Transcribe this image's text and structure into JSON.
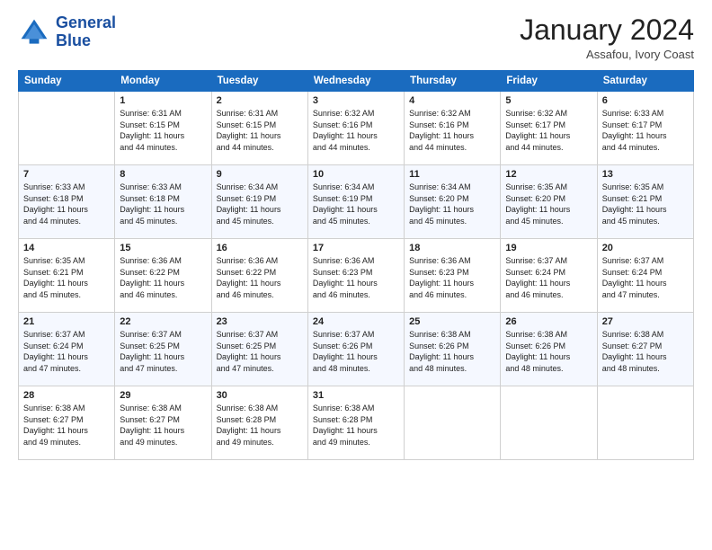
{
  "header": {
    "logo_line1": "General",
    "logo_line2": "Blue",
    "month_title": "January 2024",
    "location": "Assafou, Ivory Coast"
  },
  "weekdays": [
    "Sunday",
    "Monday",
    "Tuesday",
    "Wednesday",
    "Thursday",
    "Friday",
    "Saturday"
  ],
  "weeks": [
    [
      {
        "day": "",
        "info": ""
      },
      {
        "day": "1",
        "info": "Sunrise: 6:31 AM\nSunset: 6:15 PM\nDaylight: 11 hours\nand 44 minutes."
      },
      {
        "day": "2",
        "info": "Sunrise: 6:31 AM\nSunset: 6:15 PM\nDaylight: 11 hours\nand 44 minutes."
      },
      {
        "day": "3",
        "info": "Sunrise: 6:32 AM\nSunset: 6:16 PM\nDaylight: 11 hours\nand 44 minutes."
      },
      {
        "day": "4",
        "info": "Sunrise: 6:32 AM\nSunset: 6:16 PM\nDaylight: 11 hours\nand 44 minutes."
      },
      {
        "day": "5",
        "info": "Sunrise: 6:32 AM\nSunset: 6:17 PM\nDaylight: 11 hours\nand 44 minutes."
      },
      {
        "day": "6",
        "info": "Sunrise: 6:33 AM\nSunset: 6:17 PM\nDaylight: 11 hours\nand 44 minutes."
      }
    ],
    [
      {
        "day": "7",
        "info": "Sunrise: 6:33 AM\nSunset: 6:18 PM\nDaylight: 11 hours\nand 44 minutes."
      },
      {
        "day": "8",
        "info": "Sunrise: 6:33 AM\nSunset: 6:18 PM\nDaylight: 11 hours\nand 45 minutes."
      },
      {
        "day": "9",
        "info": "Sunrise: 6:34 AM\nSunset: 6:19 PM\nDaylight: 11 hours\nand 45 minutes."
      },
      {
        "day": "10",
        "info": "Sunrise: 6:34 AM\nSunset: 6:19 PM\nDaylight: 11 hours\nand 45 minutes."
      },
      {
        "day": "11",
        "info": "Sunrise: 6:34 AM\nSunset: 6:20 PM\nDaylight: 11 hours\nand 45 minutes."
      },
      {
        "day": "12",
        "info": "Sunrise: 6:35 AM\nSunset: 6:20 PM\nDaylight: 11 hours\nand 45 minutes."
      },
      {
        "day": "13",
        "info": "Sunrise: 6:35 AM\nSunset: 6:21 PM\nDaylight: 11 hours\nand 45 minutes."
      }
    ],
    [
      {
        "day": "14",
        "info": "Sunrise: 6:35 AM\nSunset: 6:21 PM\nDaylight: 11 hours\nand 45 minutes."
      },
      {
        "day": "15",
        "info": "Sunrise: 6:36 AM\nSunset: 6:22 PM\nDaylight: 11 hours\nand 46 minutes."
      },
      {
        "day": "16",
        "info": "Sunrise: 6:36 AM\nSunset: 6:22 PM\nDaylight: 11 hours\nand 46 minutes."
      },
      {
        "day": "17",
        "info": "Sunrise: 6:36 AM\nSunset: 6:23 PM\nDaylight: 11 hours\nand 46 minutes."
      },
      {
        "day": "18",
        "info": "Sunrise: 6:36 AM\nSunset: 6:23 PM\nDaylight: 11 hours\nand 46 minutes."
      },
      {
        "day": "19",
        "info": "Sunrise: 6:37 AM\nSunset: 6:24 PM\nDaylight: 11 hours\nand 46 minutes."
      },
      {
        "day": "20",
        "info": "Sunrise: 6:37 AM\nSunset: 6:24 PM\nDaylight: 11 hours\nand 47 minutes."
      }
    ],
    [
      {
        "day": "21",
        "info": "Sunrise: 6:37 AM\nSunset: 6:24 PM\nDaylight: 11 hours\nand 47 minutes."
      },
      {
        "day": "22",
        "info": "Sunrise: 6:37 AM\nSunset: 6:25 PM\nDaylight: 11 hours\nand 47 minutes."
      },
      {
        "day": "23",
        "info": "Sunrise: 6:37 AM\nSunset: 6:25 PM\nDaylight: 11 hours\nand 47 minutes."
      },
      {
        "day": "24",
        "info": "Sunrise: 6:37 AM\nSunset: 6:26 PM\nDaylight: 11 hours\nand 48 minutes."
      },
      {
        "day": "25",
        "info": "Sunrise: 6:38 AM\nSunset: 6:26 PM\nDaylight: 11 hours\nand 48 minutes."
      },
      {
        "day": "26",
        "info": "Sunrise: 6:38 AM\nSunset: 6:26 PM\nDaylight: 11 hours\nand 48 minutes."
      },
      {
        "day": "27",
        "info": "Sunrise: 6:38 AM\nSunset: 6:27 PM\nDaylight: 11 hours\nand 48 minutes."
      }
    ],
    [
      {
        "day": "28",
        "info": "Sunrise: 6:38 AM\nSunset: 6:27 PM\nDaylight: 11 hours\nand 49 minutes."
      },
      {
        "day": "29",
        "info": "Sunrise: 6:38 AM\nSunset: 6:27 PM\nDaylight: 11 hours\nand 49 minutes."
      },
      {
        "day": "30",
        "info": "Sunrise: 6:38 AM\nSunset: 6:28 PM\nDaylight: 11 hours\nand 49 minutes."
      },
      {
        "day": "31",
        "info": "Sunrise: 6:38 AM\nSunset: 6:28 PM\nDaylight: 11 hours\nand 49 minutes."
      },
      {
        "day": "",
        "info": ""
      },
      {
        "day": "",
        "info": ""
      },
      {
        "day": "",
        "info": ""
      }
    ]
  ]
}
